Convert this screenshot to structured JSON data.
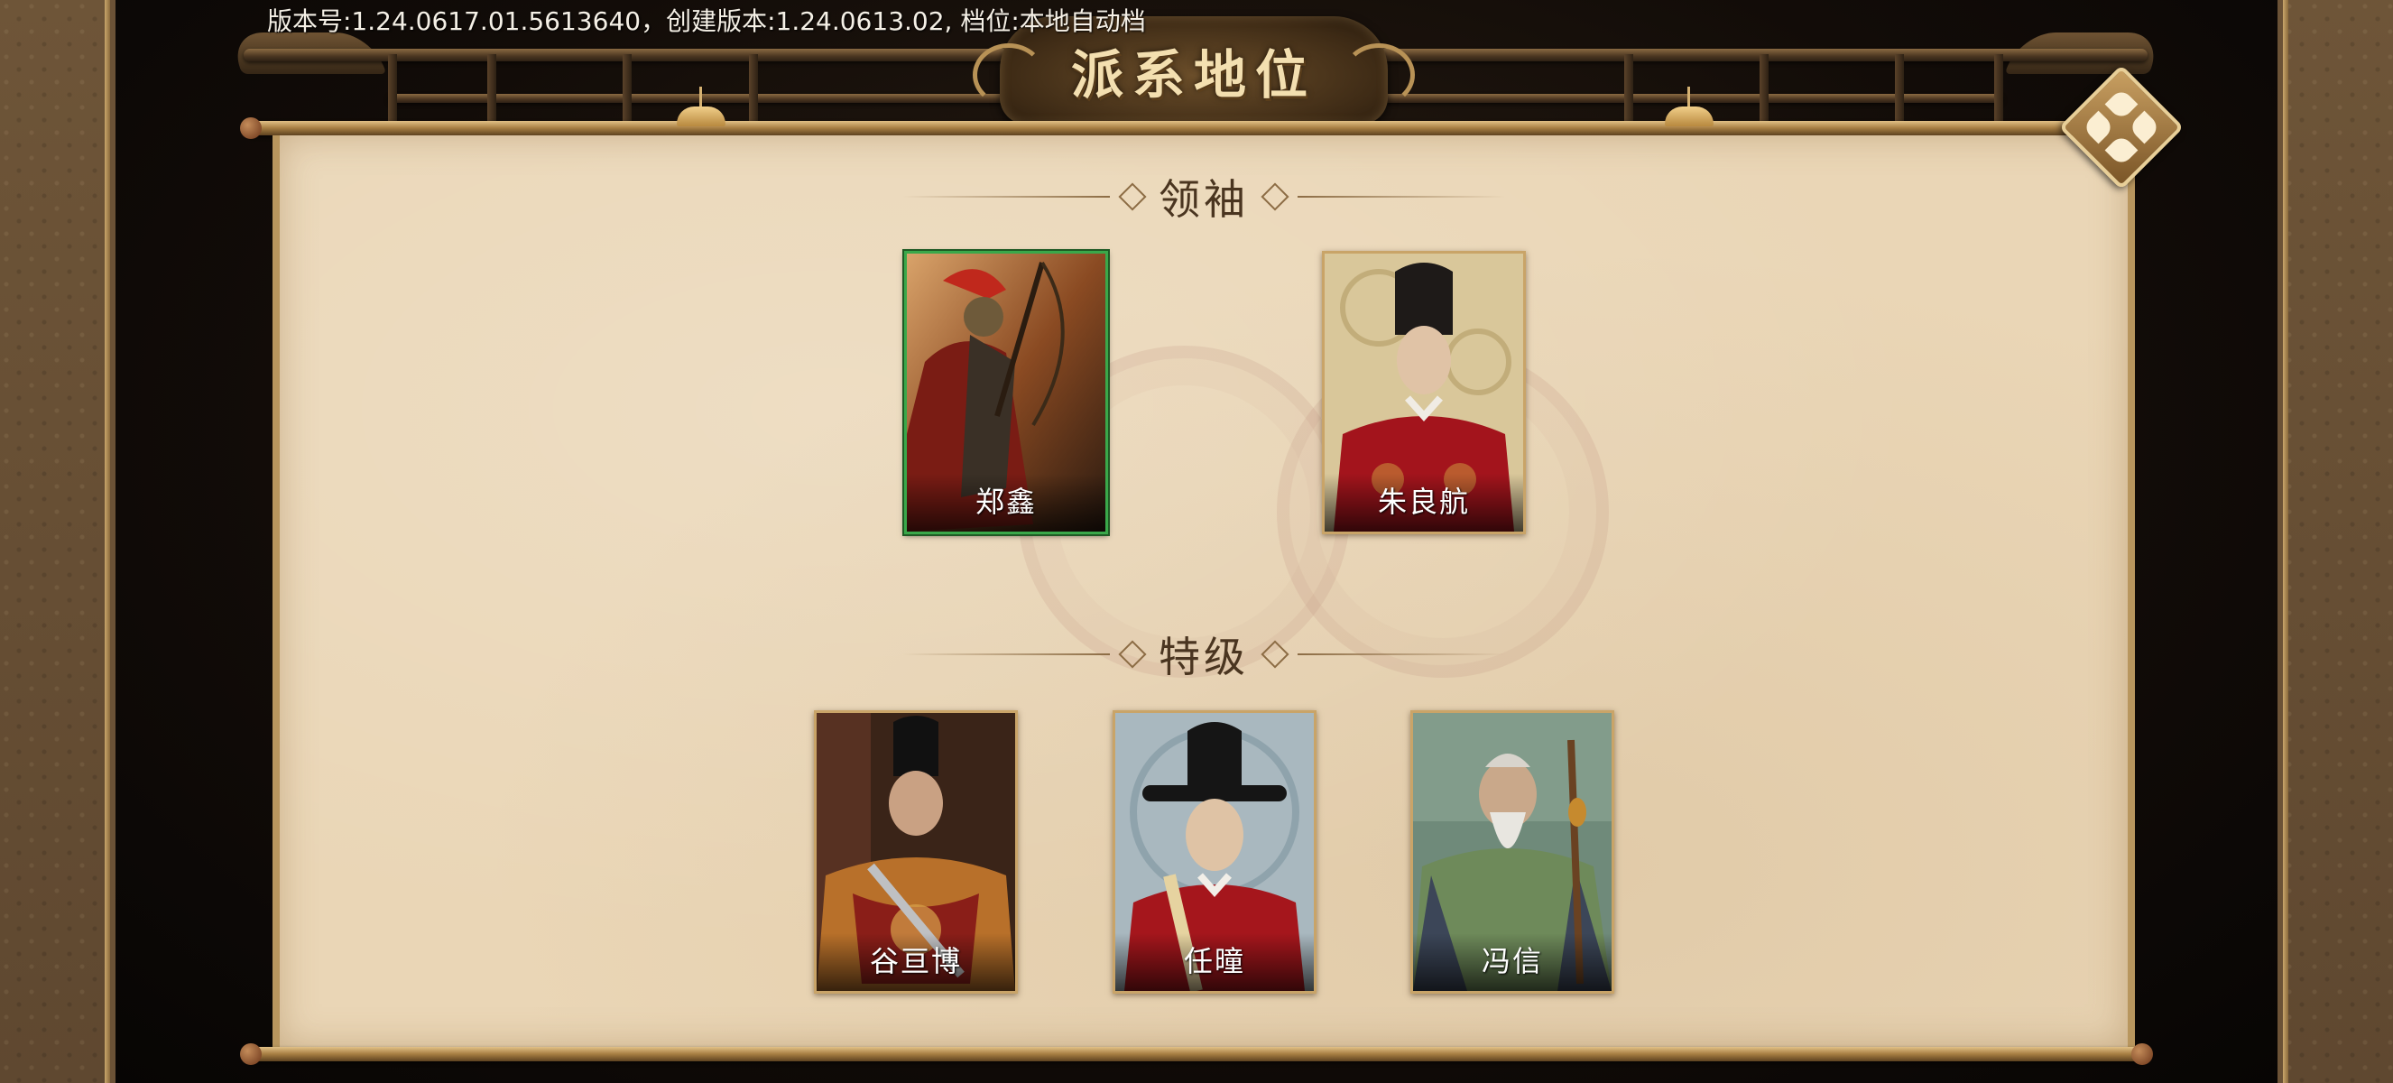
{
  "version_info": "版本号:1.24.0617.01.5613640，创建版本:1.24.0613.02, 档位:本地自动档",
  "title": "派系地位",
  "close_button": {
    "icon": "diamond-flower-icon"
  },
  "sections": {
    "leader": {
      "label": "领袖",
      "members": [
        {
          "name": "郑鑫",
          "selected": true,
          "portrait": "armored-general-portrait"
        },
        {
          "name": "朱良航",
          "selected": false,
          "portrait": "red-robed-official-portrait"
        }
      ]
    },
    "special": {
      "label": "特级",
      "members": [
        {
          "name": "谷亘博",
          "selected": false,
          "portrait": "embroidered-guard-portrait"
        },
        {
          "name": "任曈",
          "selected": false,
          "portrait": "young-official-portrait"
        },
        {
          "name": "冯信",
          "selected": false,
          "portrait": "old-sage-portrait"
        }
      ]
    }
  },
  "colors": {
    "paper": "#ead6b6",
    "frame": "#b8965e",
    "selected_border": "#3aa84a"
  }
}
